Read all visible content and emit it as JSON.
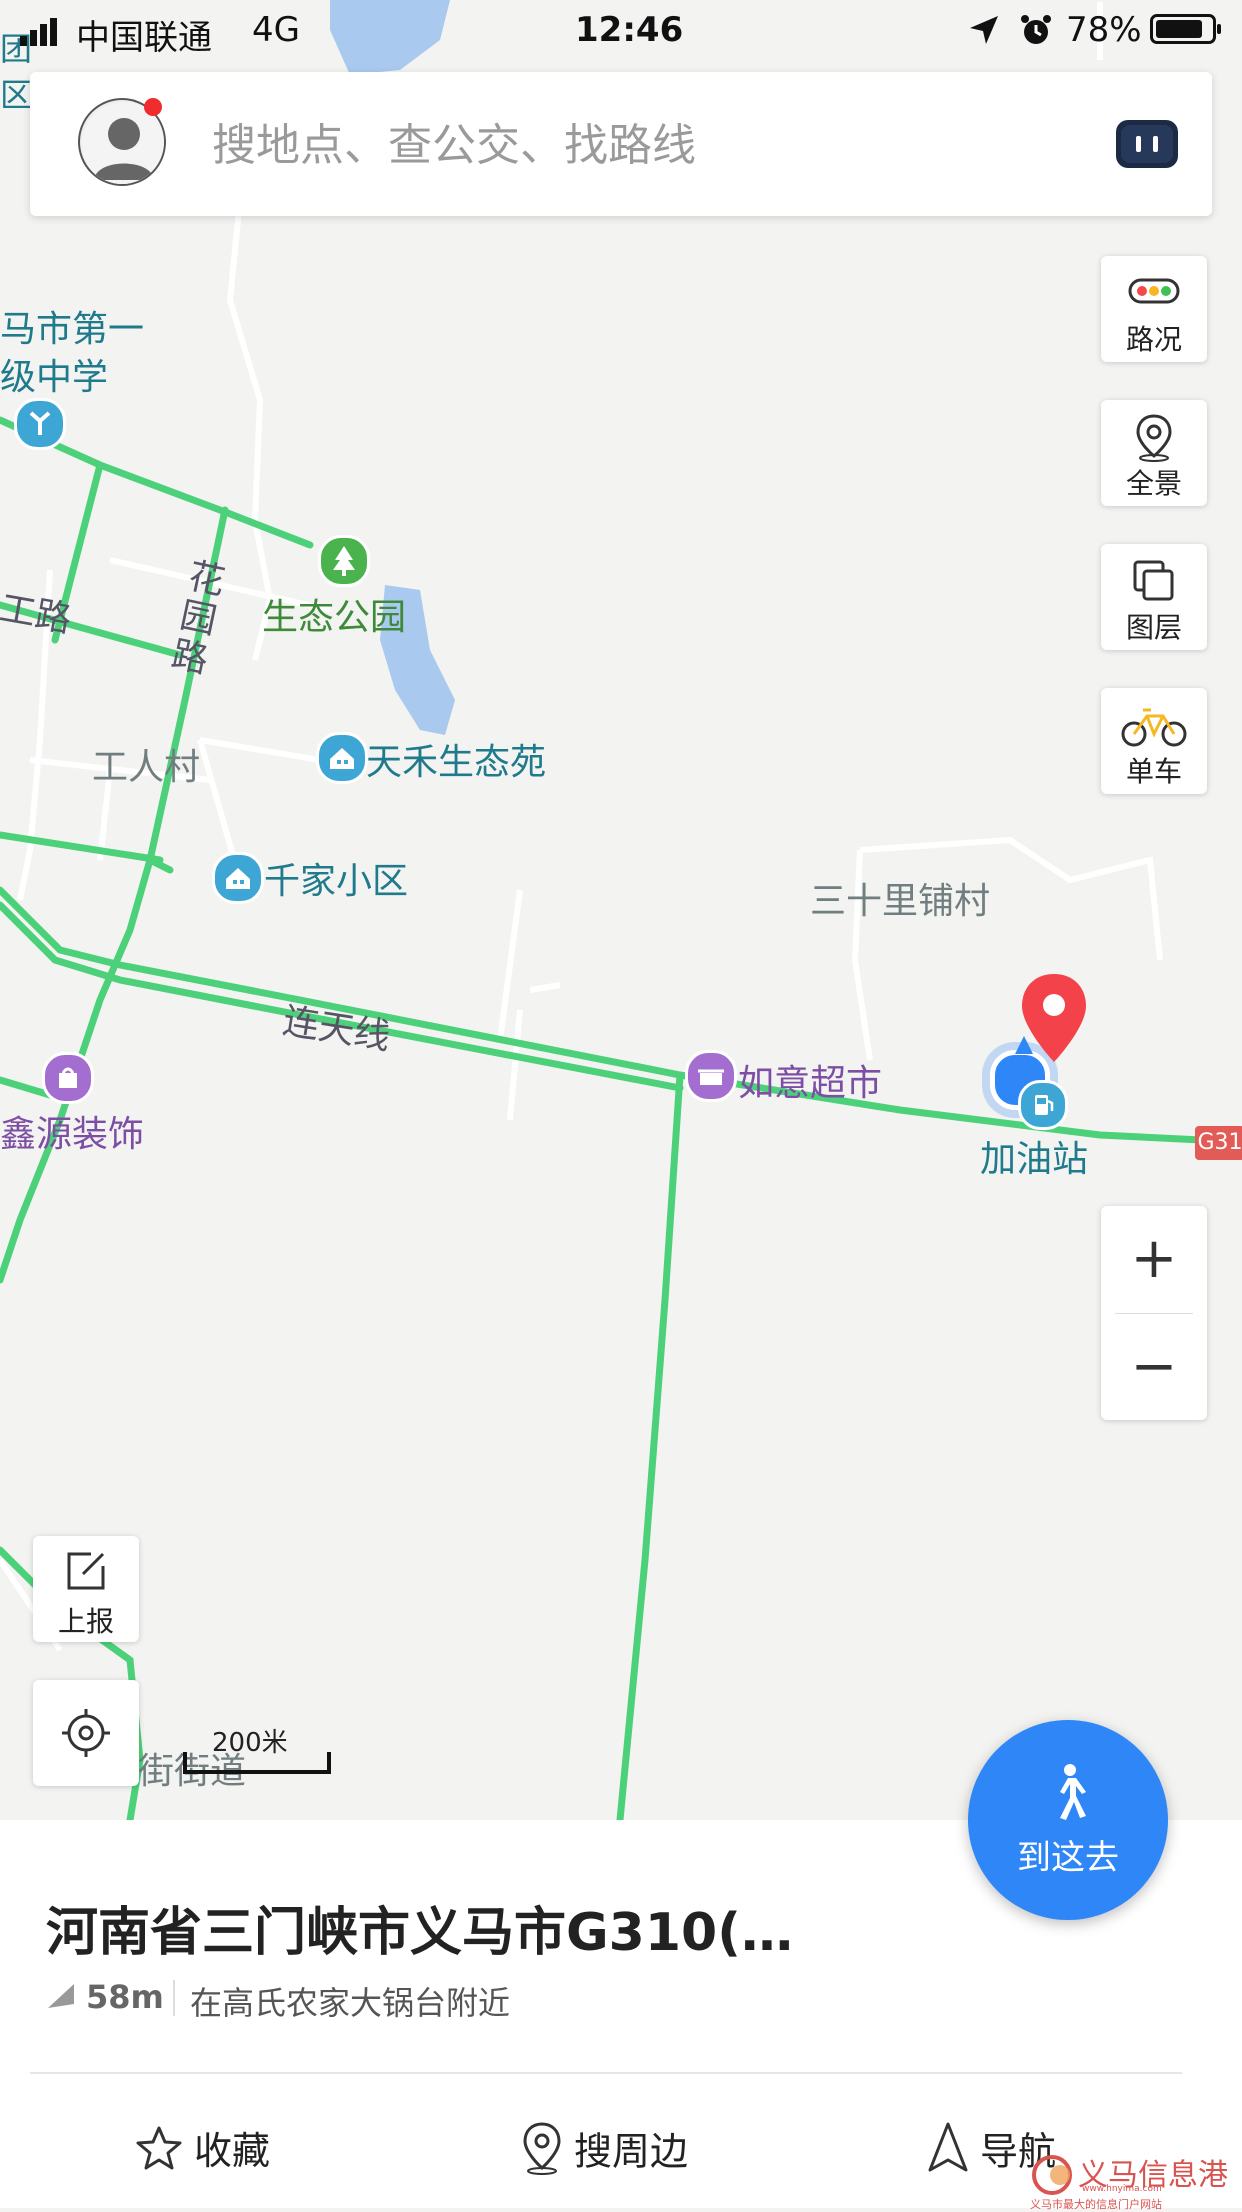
{
  "status_bar": {
    "carrier": "中国联通",
    "network": "4G",
    "time": "12:46",
    "battery": "78%"
  },
  "search": {
    "placeholder": "搜地点、查公交、找路线"
  },
  "map_controls": {
    "traffic": "路况",
    "panorama": "全景",
    "layers": "图层",
    "bike": "单车",
    "zoom_in": "+",
    "zoom_out": "−",
    "report": "上报"
  },
  "map": {
    "labels": {
      "school_line1": "马市第一",
      "school_line2": "级中学",
      "park": "生态公园",
      "road_huayuan": "花园路",
      "road_left": "工路",
      "workers_village": "工人村",
      "tianhe": "天禾生态苑",
      "qianjia": "千家小区",
      "sanshili": "三十里铺村",
      "liantian": "连天线",
      "xinyuan": "鑫源装饰",
      "ruyi": "如意超市",
      "gas": "加油站",
      "street": "街街道",
      "top_left_1": "团",
      "top_left_2": "区",
      "highway_shield": "G31"
    },
    "scale": "200米",
    "colors": {
      "road_green": "#4cd17a",
      "water": "#a9c9ef",
      "marker_red": "#f4424a",
      "location_blue": "#2f86f6"
    }
  },
  "go_here": {
    "label": "到这去"
  },
  "place": {
    "title": "河南省三门峡市义马市G310(…",
    "distance": "58m",
    "nearby": "在高氏农家大锅台附近"
  },
  "actions": {
    "favorite": "收藏",
    "search_nearby": "搜周边",
    "navigate": "导航"
  },
  "watermark": {
    "text": "义马信息港",
    "subtext": "义马市最大的信息门户网站",
    "url": "www.hnyima.com"
  }
}
